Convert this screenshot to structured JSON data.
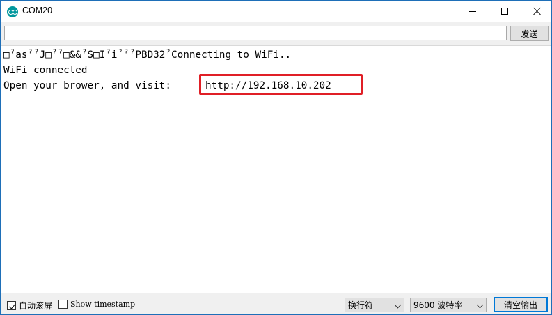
{
  "window": {
    "title": "COM20",
    "icon": "arduino-icon"
  },
  "send_bar": {
    "input_value": "",
    "send_label": "发送"
  },
  "output": {
    "lines": [
      "□ˀasˀˀJ□ˀˀ□&&ˀS□IˀiˀˀˀPBD32ˀConnecting to WiFi..",
      "WiFi connected",
      "Open your brower, and visit: "
    ],
    "highlighted_url": "http://192.168.10.202",
    "highlight_color": "#e01f26"
  },
  "bottom_bar": {
    "autoscroll_label": "自动滚屏",
    "autoscroll_checked": true,
    "timestamp_label": "Show timestamp",
    "timestamp_checked": false,
    "line_ending_value": "换行符",
    "baud_value": "9600 波特率",
    "clear_label": "清空输出"
  }
}
